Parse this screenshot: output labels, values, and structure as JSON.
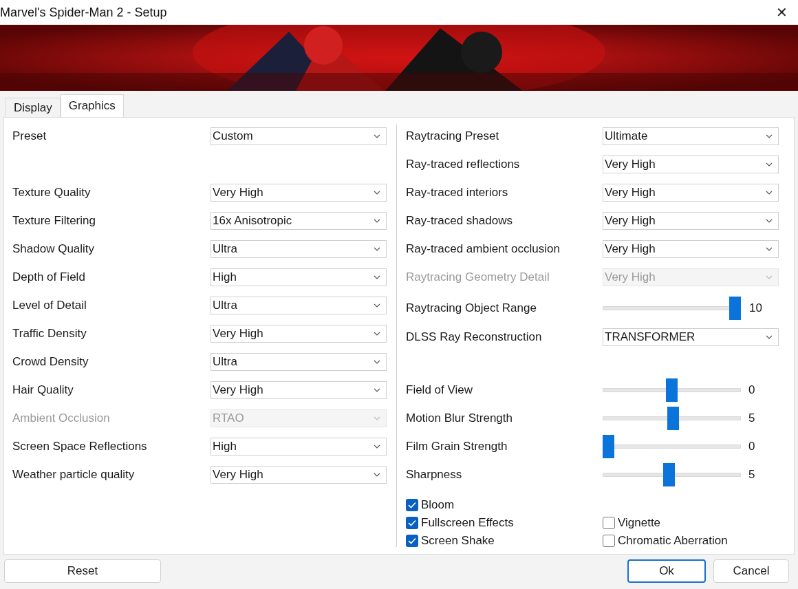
{
  "window": {
    "title": "Marvel's Spider-Man 2 - Setup",
    "close": "✕"
  },
  "tabs": [
    {
      "label": "Display",
      "selected": false
    },
    {
      "label": "Graphics",
      "selected": true
    }
  ],
  "left": {
    "preset": {
      "label": "Preset",
      "value": "Custom",
      "disabled": false
    },
    "settings": [
      {
        "label": "Texture Quality",
        "value": "Very High",
        "disabled": false
      },
      {
        "label": "Texture Filtering",
        "value": "16x Anisotropic",
        "disabled": false
      },
      {
        "label": "Shadow Quality",
        "value": "Ultra",
        "disabled": false
      },
      {
        "label": "Depth of Field",
        "value": "High",
        "disabled": false
      },
      {
        "label": "Level of Detail",
        "value": "Ultra",
        "disabled": false
      },
      {
        "label": "Traffic Density",
        "value": "Very High",
        "disabled": false
      },
      {
        "label": "Crowd Density",
        "value": "Ultra",
        "disabled": false
      },
      {
        "label": "Hair Quality",
        "value": "Very High",
        "disabled": false
      },
      {
        "label": "Ambient Occlusion",
        "value": "RTAO",
        "disabled": true
      },
      {
        "label": "Screen Space Reflections",
        "value": "High",
        "disabled": false
      },
      {
        "label": "Weather particle quality",
        "value": "Very High",
        "disabled": false
      }
    ]
  },
  "right": {
    "raytracing": [
      {
        "kind": "dropdown",
        "label": "Raytracing Preset",
        "value": "Ultimate",
        "disabled": false
      },
      {
        "kind": "dropdown",
        "label": "Ray-traced reflections",
        "value": "Very High",
        "disabled": false
      },
      {
        "kind": "dropdown",
        "label": "Ray-traced interiors",
        "value": "Very High",
        "disabled": false
      },
      {
        "kind": "dropdown",
        "label": "Ray-traced shadows",
        "value": "Very High",
        "disabled": false
      },
      {
        "kind": "dropdown",
        "label": "Ray-traced ambient occlusion",
        "value": "Very High",
        "disabled": false
      },
      {
        "kind": "dropdown",
        "label": "Raytracing Geometry Detail",
        "value": "Very High",
        "disabled": true
      },
      {
        "kind": "slider",
        "label": "Raytracing Object Range",
        "level": 1,
        "reading": "10"
      },
      {
        "kind": "dropdown",
        "label": "DLSS Ray Reconstruction",
        "value": "TRANSFORMER",
        "disabled": false
      }
    ],
    "effects": [
      {
        "label": "Field of View",
        "level": 0.5,
        "reading": "0"
      },
      {
        "label": "Motion Blur Strength",
        "level": 0.51,
        "reading": "5"
      },
      {
        "label": "Film Grain Strength",
        "level": 0,
        "reading": "0"
      },
      {
        "label": "Sharpness",
        "level": 0.48,
        "reading": "5"
      }
    ],
    "checkboxes_column_1": [
      {
        "label": "Bloom",
        "checked": true
      },
      {
        "label": "Fullscreen Effects",
        "checked": true
      },
      {
        "label": "Screen Shake",
        "checked": true
      }
    ],
    "checkboxes_column_2": [
      {
        "label": "Vignette",
        "checked": false
      },
      {
        "label": "Chromatic Aberration",
        "checked": false
      }
    ]
  },
  "buttons": {
    "reset": "Reset",
    "ok": "Ok",
    "cancel": "Cancel"
  }
}
